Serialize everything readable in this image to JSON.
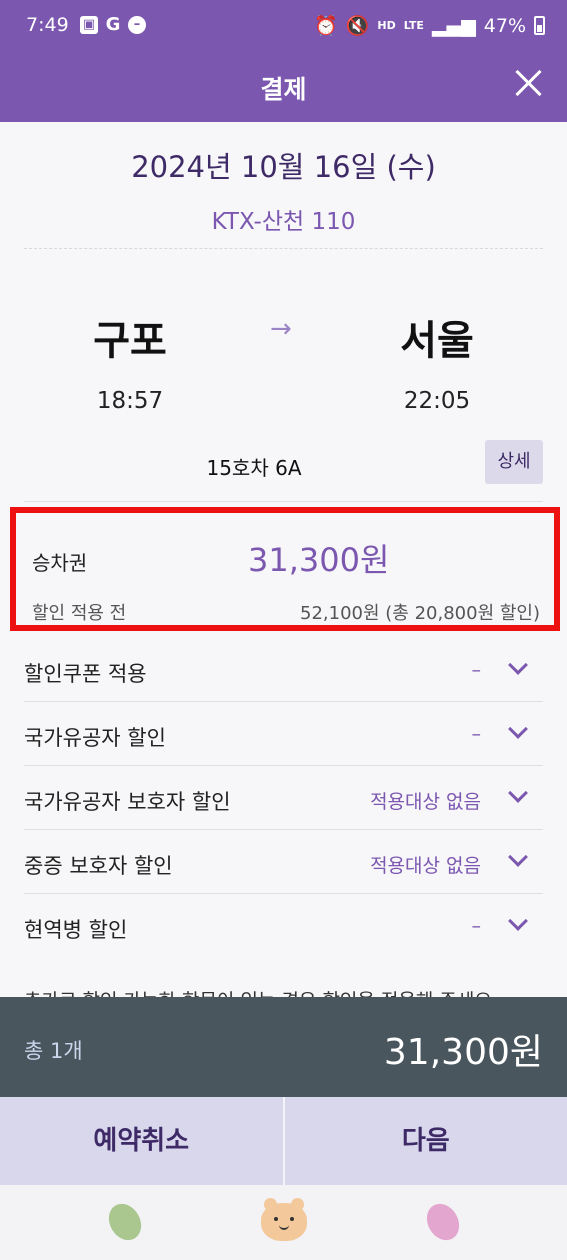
{
  "status_bar": {
    "time": "7:49",
    "g_letter": "G",
    "hd_label": "HD",
    "lte_label": "LTE",
    "battery": "47%"
  },
  "header": {
    "title": "결제",
    "close_icon": "close-icon"
  },
  "trip": {
    "date": "2024년 10월 16일 (수)",
    "train": "KTX-산천 110",
    "departure": {
      "station": "구포",
      "time": "18:57"
    },
    "arrow_icon": "→",
    "arrival": {
      "station": "서울",
      "time": "22:05"
    },
    "seat": "15호차 6A",
    "detail_label": "상세"
  },
  "ticket": {
    "label": "승차권",
    "price": "31,300원",
    "pre_discount_label": "할인 적용 전",
    "pre_discount_value": "52,100원 (총 20,800원 할인)"
  },
  "discounts": [
    {
      "label": "할인쿠폰 적용",
      "value": "–"
    },
    {
      "label": "국가유공자 할인",
      "value": "–"
    },
    {
      "label": "국가유공자 보호자 할인",
      "value": "적용대상 없음"
    },
    {
      "label": "중증 보호자 할인",
      "value": "적용대상 없음"
    },
    {
      "label": "현역병 할인",
      "value": "–"
    }
  ],
  "hint": "추가로 할인 가능한 항목이 있는 경우 할인을 적용해 주세요.",
  "total": {
    "count": "총 1개",
    "amount": "31,300원"
  },
  "actions": {
    "cancel": "예약취소",
    "next": "다음"
  },
  "colors": {
    "brand": "#7b57b0",
    "highlight_border": "#ee1111",
    "total_bar": "#4a565e",
    "action_bar": "#d9d7ec"
  },
  "bottom_nav": [
    "green-bean-icon",
    "bear-icon",
    "pink-bean-icon"
  ]
}
